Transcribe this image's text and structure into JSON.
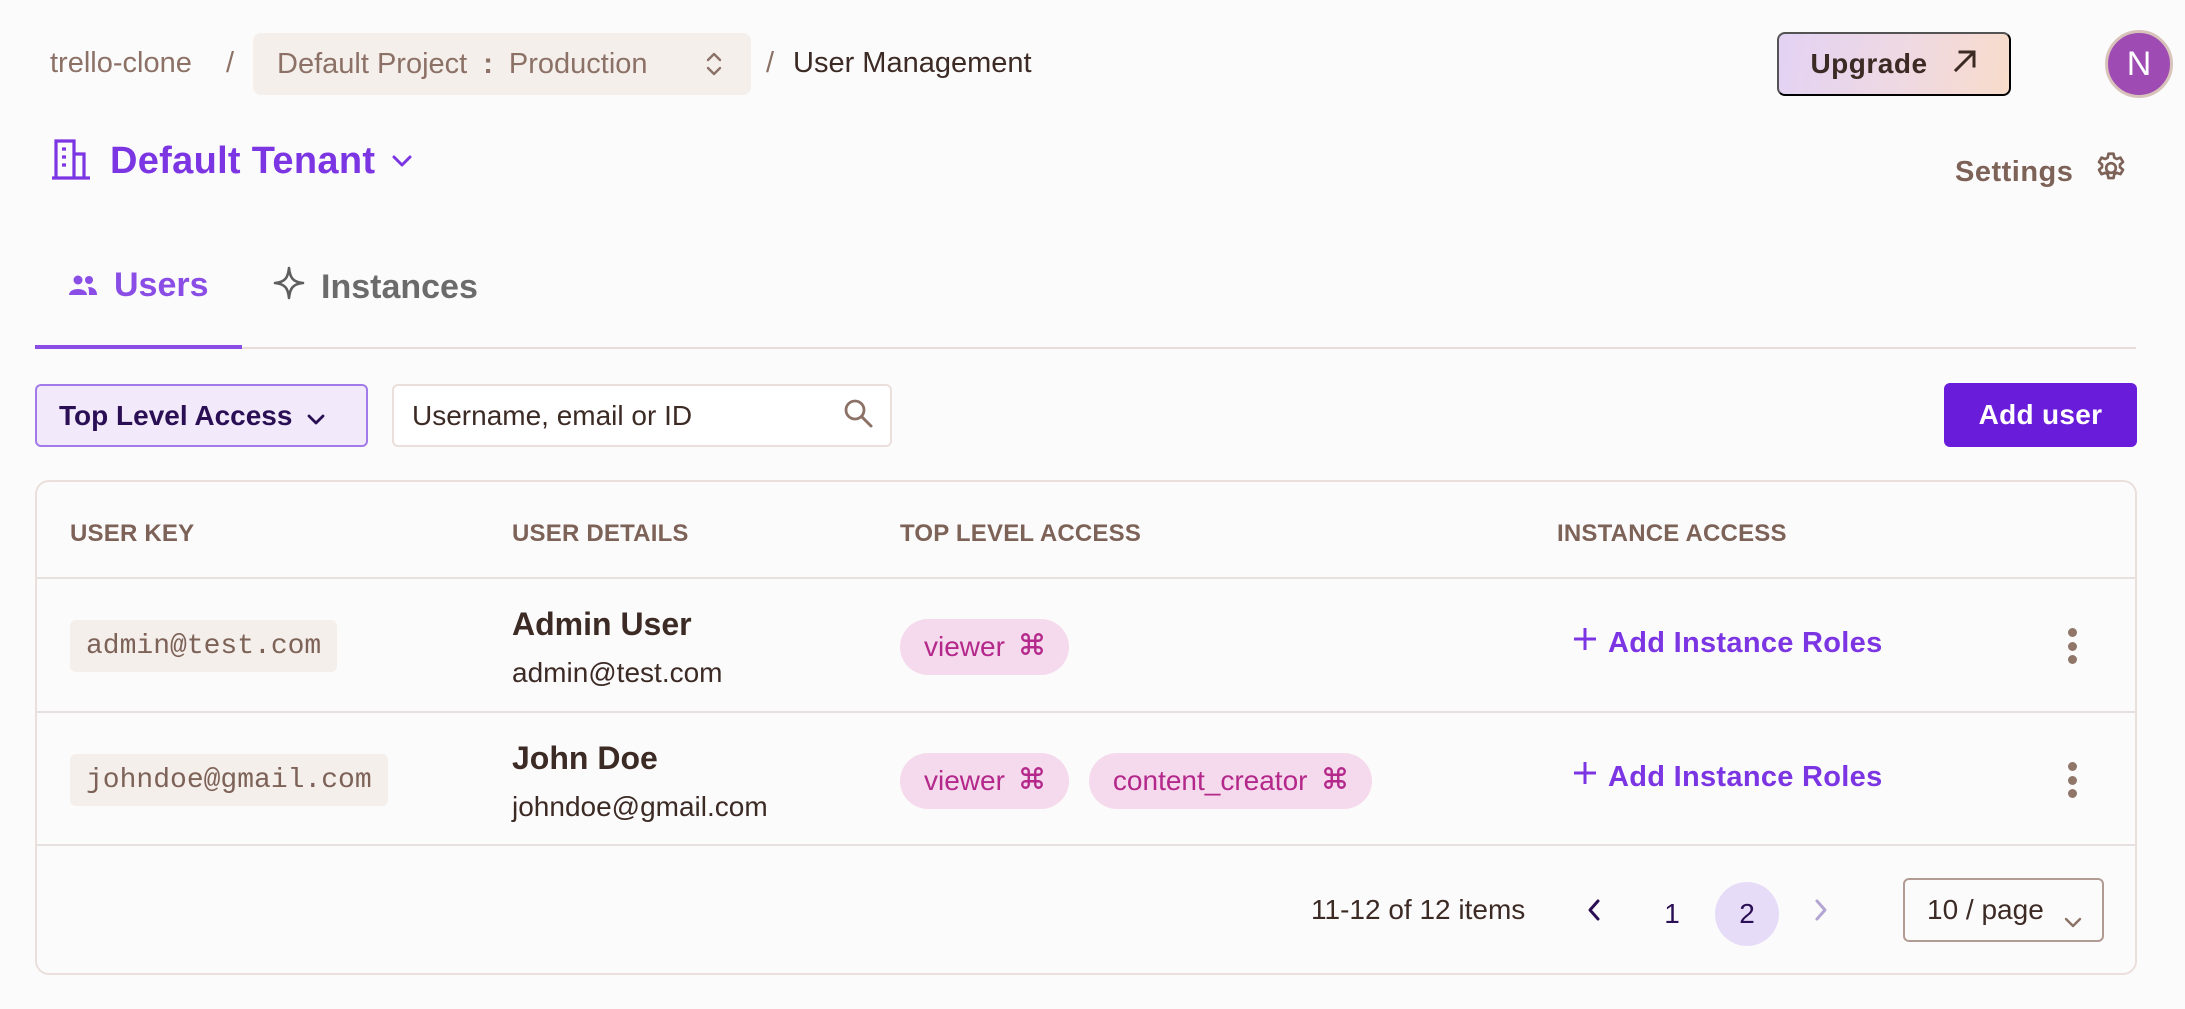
{
  "breadcrumb": {
    "org": "trello-clone",
    "separator": "/",
    "project": "Default Project",
    "environment": "Production",
    "project_env_separator": ":",
    "current": "User Management"
  },
  "header": {
    "upgrade_label": "Upgrade",
    "avatar_initial": "N",
    "avatar_color": "#9e4cb3",
    "tenant_name": "Default Tenant",
    "settings_label": "Settings"
  },
  "tabs": [
    {
      "label": "Users",
      "icon": "users-icon",
      "active": true
    },
    {
      "label": "Instances",
      "icon": "sparkle-icon",
      "active": false
    }
  ],
  "toolbar": {
    "filter_label": "Top Level Access",
    "search_placeholder": "Username, email or ID",
    "search_value": "",
    "add_user_label": "Add user"
  },
  "table": {
    "columns": [
      "USER KEY",
      "USER DETAILS",
      "TOP LEVEL ACCESS",
      "INSTANCE ACCESS"
    ],
    "rows": [
      {
        "key": "admin@test.com",
        "name": "Admin User",
        "email": "admin@test.com",
        "roles": [
          "viewer"
        ],
        "instance_action": "Add Instance Roles"
      },
      {
        "key": "johndoe@gmail.com",
        "name": "John Doe",
        "email": "johndoe@gmail.com",
        "roles": [
          "viewer",
          "content_creator"
        ],
        "instance_action": "Add Instance Roles"
      }
    ]
  },
  "pagination": {
    "summary": "11-12 of 12 items",
    "pages": [
      "1",
      "2"
    ],
    "current_page": "2",
    "page_size": "10 / page"
  },
  "colors": {
    "accent": "#7b35e3",
    "primary_button": "#6a1cdb",
    "role_badge_bg": "#f5d9ec",
    "role_badge_text": "#b3288a"
  }
}
